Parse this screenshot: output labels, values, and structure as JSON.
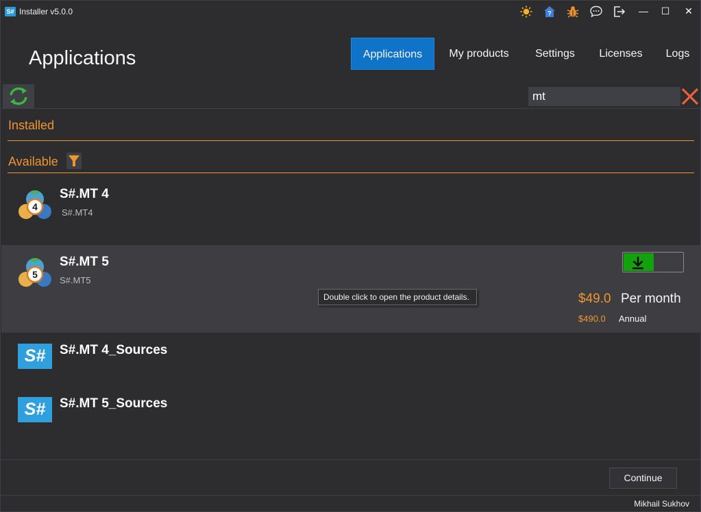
{
  "window": {
    "title": "Installer v5.0.0",
    "app_icon_text": "S#",
    "toolbar_icons": [
      "theme-sun-icon",
      "help-home-icon",
      "bug-report-icon",
      "chat-icon",
      "logout-icon"
    ],
    "controls": {
      "minimize": "—",
      "maximize": "☐",
      "close": "✕"
    }
  },
  "header": {
    "page_title": "Applications",
    "tabs": [
      {
        "label": "Applications",
        "active": true
      },
      {
        "label": "My products",
        "active": false
      },
      {
        "label": "Settings",
        "active": false
      },
      {
        "label": "Licenses",
        "active": false
      },
      {
        "label": "Logs",
        "active": false
      }
    ]
  },
  "search": {
    "value": "mt"
  },
  "sections": {
    "installed_label": "Installed",
    "available_label": "Available"
  },
  "products": [
    {
      "name": "S#.MT 4",
      "sub": "S#.MT4",
      "logo": "metatrader-4-icon",
      "logo_badge": "4"
    },
    {
      "name": "S#.MT 5",
      "sub": "S#.MT5",
      "logo": "metatrader-5-icon",
      "logo_badge": "5",
      "selected": true,
      "price_monthly": "$49.0",
      "period_monthly": "Per month",
      "price_annual": "$490.0",
      "period_annual": "Annual"
    },
    {
      "name": "S#.MT 4_Sources",
      "logo": "stocksharp-icon",
      "logo_text": "S#"
    },
    {
      "name": "S#.MT 5_Sources",
      "logo": "stocksharp-icon",
      "logo_text": "S#"
    }
  ],
  "tooltip": "Double click to open the product details.",
  "footer": {
    "continue_label": "Continue",
    "user": "Mikhail Sukhov"
  },
  "colors": {
    "background": "#2d2d30",
    "accent_orange": "#f0952e",
    "tab_active": "#0f73c8",
    "download_green": "#13a10e",
    "refresh_green": "#3cb83c",
    "clear_red": "#f0603a"
  }
}
